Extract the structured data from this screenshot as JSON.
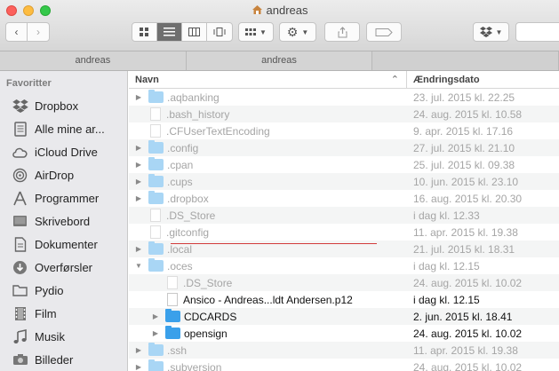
{
  "window": {
    "title": "andreas"
  },
  "tabs": [
    {
      "label": "andreas"
    },
    {
      "label": "andreas"
    }
  ],
  "sidebar": {
    "heading": "Favoritter",
    "items": [
      {
        "label": "Dropbox",
        "icon": "dropbox-icon"
      },
      {
        "label": "Alle mine ar...",
        "icon": "all-files-icon"
      },
      {
        "label": "iCloud Drive",
        "icon": "cloud-icon"
      },
      {
        "label": "AirDrop",
        "icon": "airdrop-icon"
      },
      {
        "label": "Programmer",
        "icon": "applications-icon"
      },
      {
        "label": "Skrivebord",
        "icon": "desktop-icon"
      },
      {
        "label": "Dokumenter",
        "icon": "documents-icon"
      },
      {
        "label": "Overførsler",
        "icon": "downloads-icon"
      },
      {
        "label": "Pydio",
        "icon": "folder-icon"
      },
      {
        "label": "Film",
        "icon": "film-icon"
      },
      {
        "label": "Musik",
        "icon": "music-icon"
      },
      {
        "label": "Billeder",
        "icon": "camera-icon"
      }
    ]
  },
  "columns": {
    "name": "Navn",
    "date": "Ændringsdato"
  },
  "rows": [
    {
      "name": ".aqbanking",
      "date": "23. jul. 2015 kl. 22.25",
      "kind": "folder",
      "indent": 0,
      "disclosure": "closed",
      "dim": true
    },
    {
      "name": ".bash_history",
      "date": "24. aug. 2015 kl. 10.58",
      "kind": "file",
      "indent": 0,
      "disclosure": "",
      "dim": true
    },
    {
      "name": ".CFUserTextEncoding",
      "date": "9. apr. 2015 kl. 17.16",
      "kind": "file",
      "indent": 0,
      "disclosure": "",
      "dim": true
    },
    {
      "name": ".config",
      "date": "27. jul. 2015 kl. 21.10",
      "kind": "folder",
      "indent": 0,
      "disclosure": "closed",
      "dim": true
    },
    {
      "name": ".cpan",
      "date": "25. jul. 2015 kl. 09.38",
      "kind": "folder",
      "indent": 0,
      "disclosure": "closed",
      "dim": true
    },
    {
      "name": ".cups",
      "date": "10. jun. 2015 kl. 23.10",
      "kind": "folder",
      "indent": 0,
      "disclosure": "closed",
      "dim": true
    },
    {
      "name": ".dropbox",
      "date": "16. aug. 2015 kl. 20.30",
      "kind": "folder",
      "indent": 0,
      "disclosure": "closed",
      "dim": true
    },
    {
      "name": ".DS_Store",
      "date": "i dag kl. 12.33",
      "kind": "file",
      "indent": 0,
      "disclosure": "",
      "dim": true
    },
    {
      "name": ".gitconfig",
      "date": "11. apr. 2015 kl. 19.38",
      "kind": "file",
      "indent": 0,
      "disclosure": "",
      "dim": true
    },
    {
      "name": ".local",
      "date": "21. jul. 2015 kl. 18.31",
      "kind": "folder",
      "indent": 0,
      "disclosure": "closed",
      "dim": true
    },
    {
      "name": ".oces",
      "date": "i dag kl. 12.15",
      "kind": "folder",
      "indent": 0,
      "disclosure": "open",
      "dim": true
    },
    {
      "name": ".DS_Store",
      "date": "24. aug. 2015 kl. 10.02",
      "kind": "file",
      "indent": 1,
      "disclosure": "",
      "dim": true
    },
    {
      "name": "Ansico - Andreas...ldt Andersen.p12",
      "date": "i dag kl. 12.15",
      "kind": "file",
      "indent": 1,
      "disclosure": "",
      "dim": false
    },
    {
      "name": "CDCARDS",
      "date": "2. jun. 2015 kl. 18.41",
      "kind": "folder-strong",
      "indent": 1,
      "disclosure": "closed",
      "dim": false
    },
    {
      "name": "opensign",
      "date": "24. aug. 2015 kl. 10.02",
      "kind": "folder-strong",
      "indent": 1,
      "disclosure": "closed",
      "dim": false
    },
    {
      "name": ".ssh",
      "date": "11. apr. 2015 kl. 19.38",
      "kind": "folder",
      "indent": 0,
      "disclosure": "closed",
      "dim": true
    },
    {
      "name": ".subversion",
      "date": "24. aug. 2015 kl. 10.02",
      "kind": "folder",
      "indent": 0,
      "disclosure": "closed",
      "dim": true
    }
  ],
  "colors": {
    "folder": "#a9d6f5",
    "folder_strong": "#3aa0ea",
    "annotation": "#d23b3b"
  }
}
